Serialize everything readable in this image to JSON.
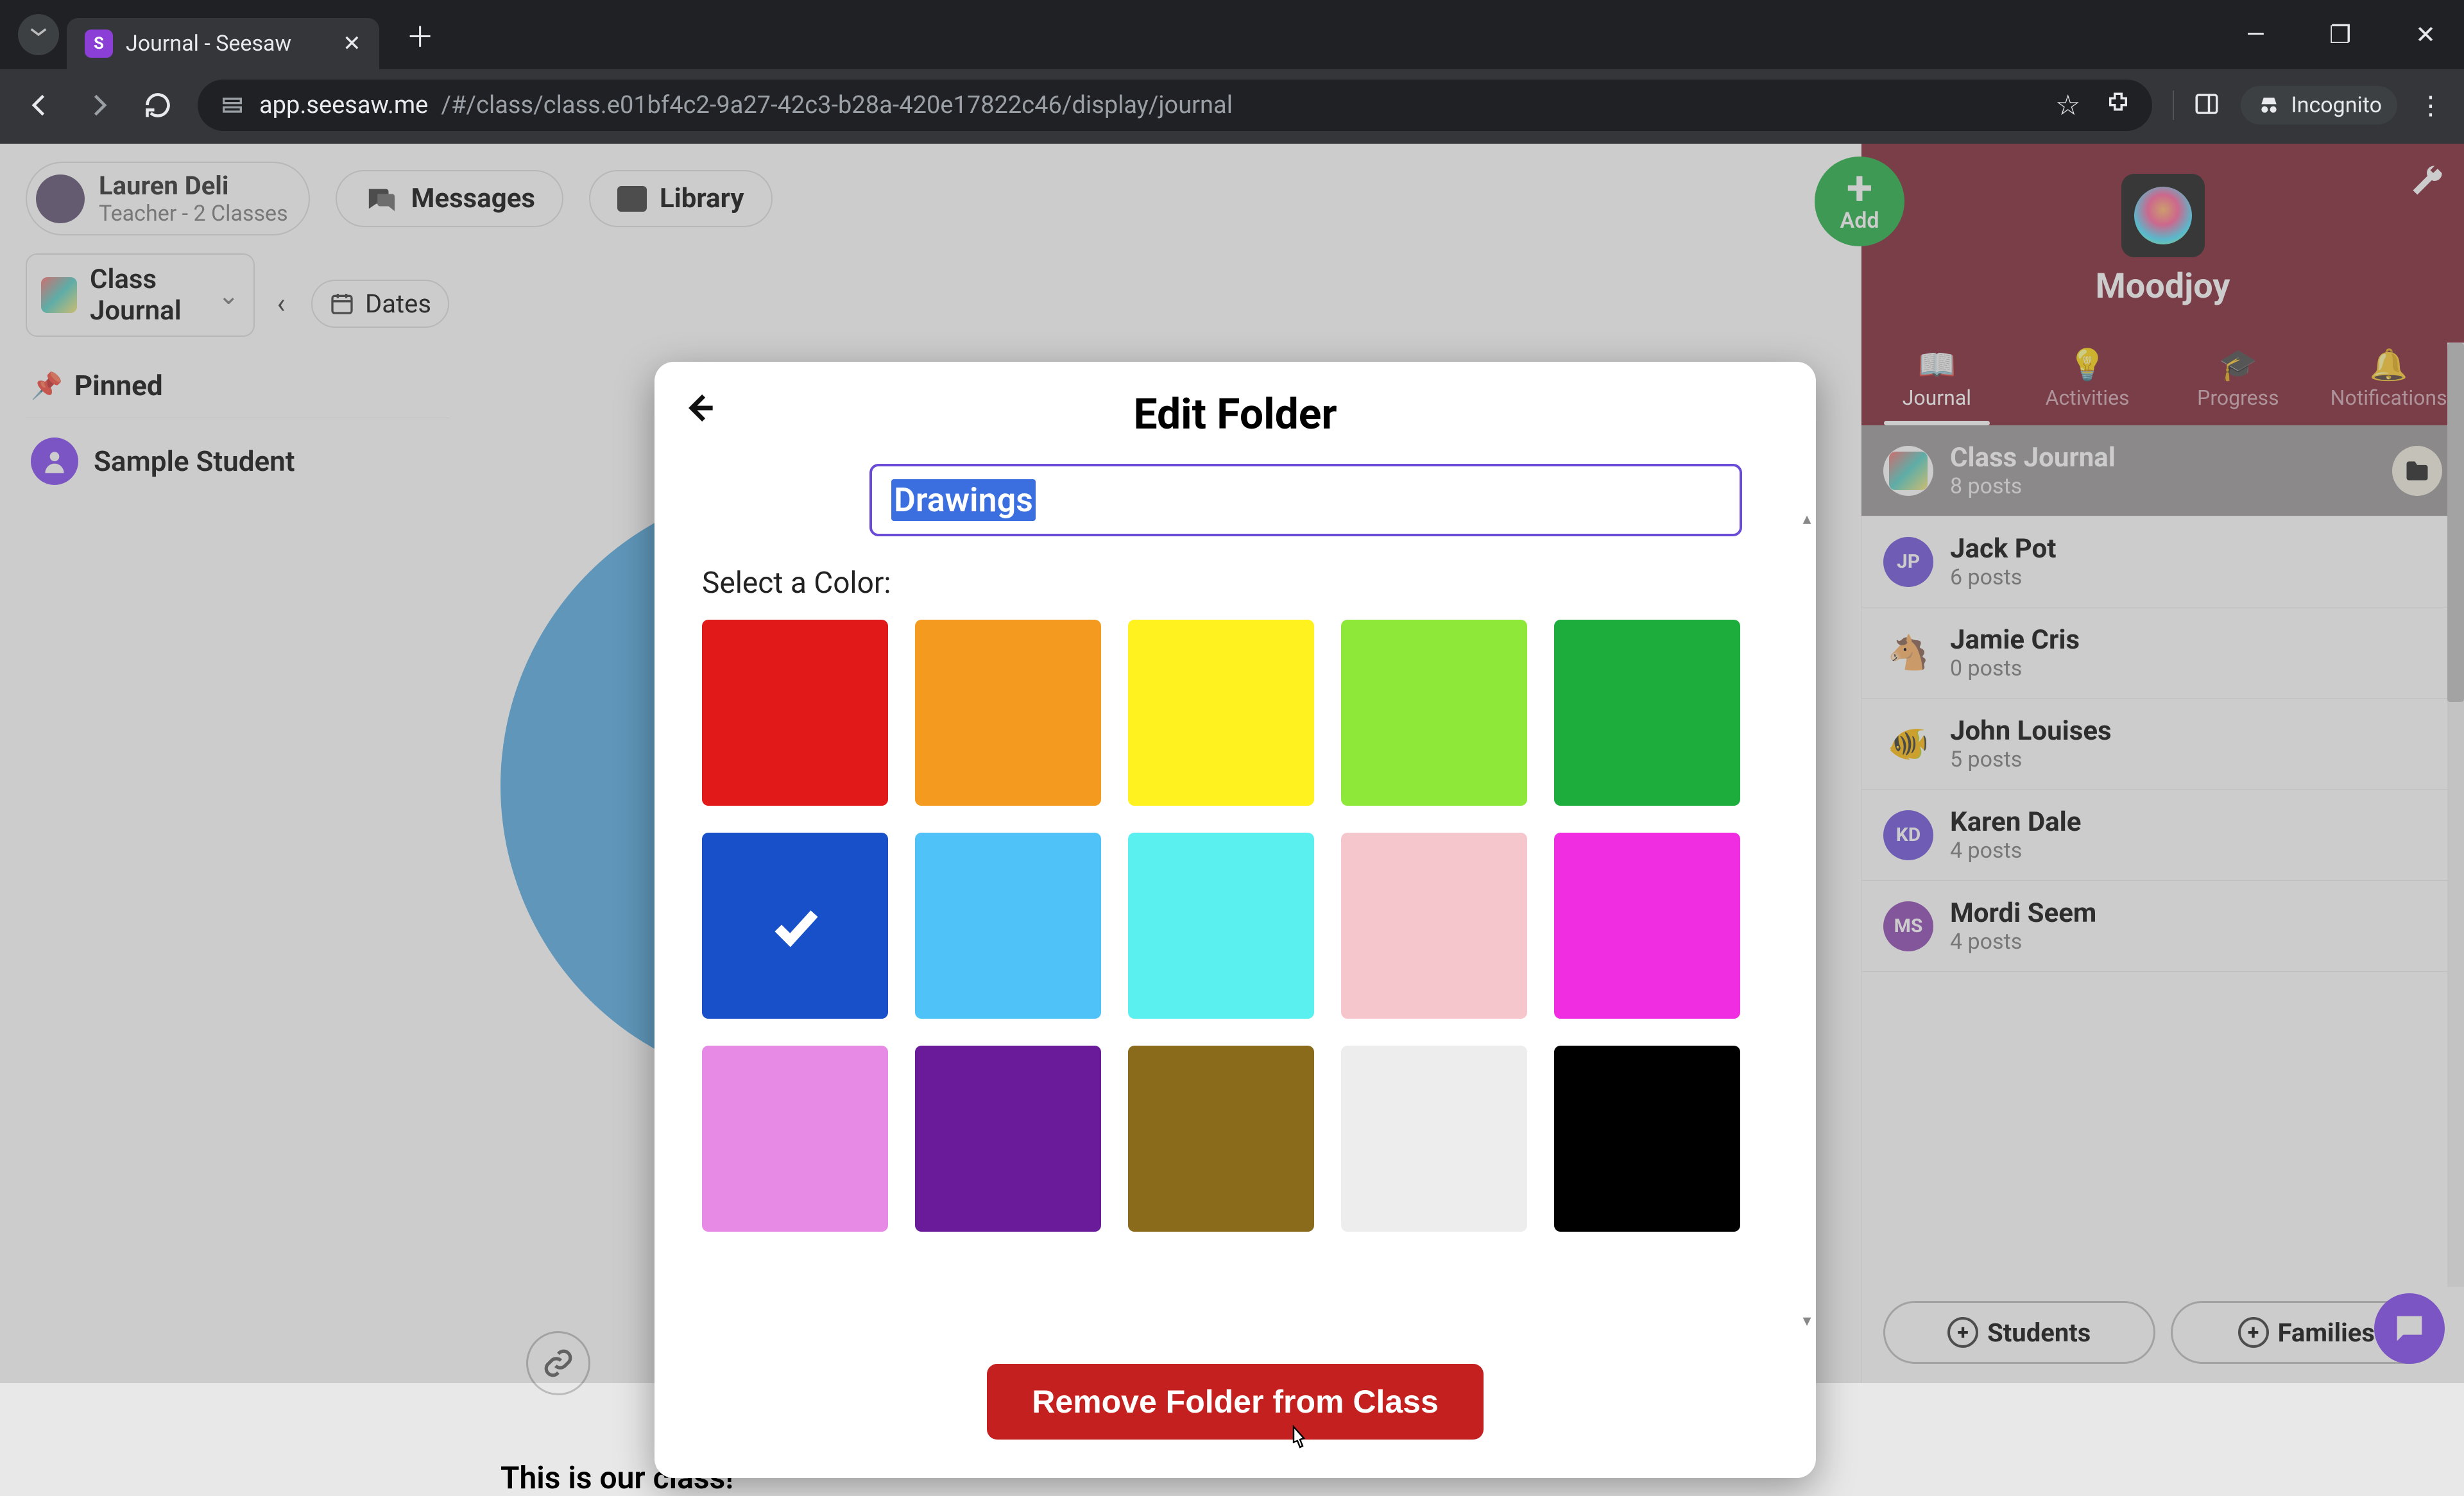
{
  "browser": {
    "tab_title": "Journal - Seesaw",
    "tab_favicon_letter": "S",
    "url_host": "app.seesaw.me",
    "url_path": "/#/class/class.e01bf4c2-9a27-42c3-b28a-420e17822c46/display/journal",
    "incognito_label": "Incognito"
  },
  "header": {
    "user_name": "Lauren Deli",
    "user_sub": "Teacher - 2 Classes",
    "nav_messages": "Messages",
    "nav_library": "Library",
    "add_label": "Add"
  },
  "left": {
    "journal_label": "Class Journal",
    "dates_label": "Dates",
    "pinned_label": "Pinned",
    "student_name": "Sample Student"
  },
  "center": {
    "caption": "This is our class!"
  },
  "right": {
    "class_title": "Moodjoy",
    "tabs": {
      "journal": "Journal",
      "activities": "Activities",
      "progress": "Progress",
      "notifications": "Notifications"
    },
    "rows": [
      {
        "title": "Class Journal",
        "sub": "8 posts",
        "kind": "class",
        "initials": ""
      },
      {
        "title": "Jack Pot",
        "sub": "6 posts",
        "kind": "initials",
        "initials": "JP",
        "color": "#6a4bd8"
      },
      {
        "title": "Jamie Cris",
        "sub": "0 posts",
        "kind": "emoji",
        "initials": "🐴"
      },
      {
        "title": "John Louises",
        "sub": "5 posts",
        "kind": "emoji",
        "initials": "🐠"
      },
      {
        "title": "Karen Dale",
        "sub": "4 posts",
        "kind": "initials",
        "initials": "KD",
        "color": "#6a4bd8"
      },
      {
        "title": "Mordi Seem",
        "sub": "4 posts",
        "kind": "initials",
        "initials": "MS",
        "color": "#8a3fb0"
      }
    ],
    "students_btn": "Students",
    "families_btn": "Families"
  },
  "modal": {
    "title": "Edit Folder",
    "folder_name": "Drawings",
    "select_color_label": "Select a Color:",
    "remove_label": "Remove Folder from Class",
    "colors": [
      "#e11919",
      "#f39a1f",
      "#fff21f",
      "#8de83a",
      "#1dad3c",
      "#1850c9",
      "#4fc3f7",
      "#5af0f0",
      "#f6c6cd",
      "#f02de0",
      "#e68ae6",
      "#6a1b9a",
      "#8a6a1b",
      "#ededed",
      "#000000"
    ],
    "selected_color_index": 5
  }
}
